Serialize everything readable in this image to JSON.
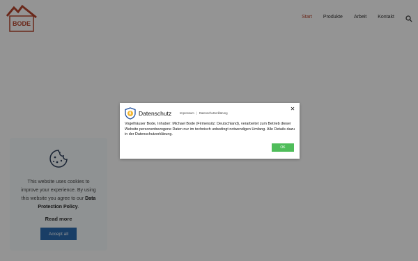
{
  "header": {
    "logo_text": "BODE",
    "nav": [
      "Start",
      "Produkte",
      "Arbeit",
      "Kontakt"
    ],
    "search_icon": "search-icon"
  },
  "cookie_banner": {
    "icon": "cookie-icon",
    "text_before": "This website uses cookies to improve your experience. By using this website you agree to our",
    "policy_link": "Data Protection Policy",
    "text_after": ".",
    "read_more": "Read more",
    "accept": "Accept all"
  },
  "modal": {
    "title": "Datenschutz",
    "links": [
      "Impressum",
      "Datenschutzerklärung"
    ],
    "separator": "|",
    "body": "Vogelhäuser Bode, Inhaber: Michael Bode (Firmensitz: Deutschland), verarbeitet zum Betrieb dieser Website personenbezogene Daten nur im technisch unbedingt notwendigen Umfang. Alle Details dazu in der Datenschutzerklärung.",
    "ok": "OK",
    "close": "✕"
  },
  "colors": {
    "brand": "#b7462e",
    "ok_button": "#4fbd5a",
    "accept_button": "#2b6cb0"
  }
}
